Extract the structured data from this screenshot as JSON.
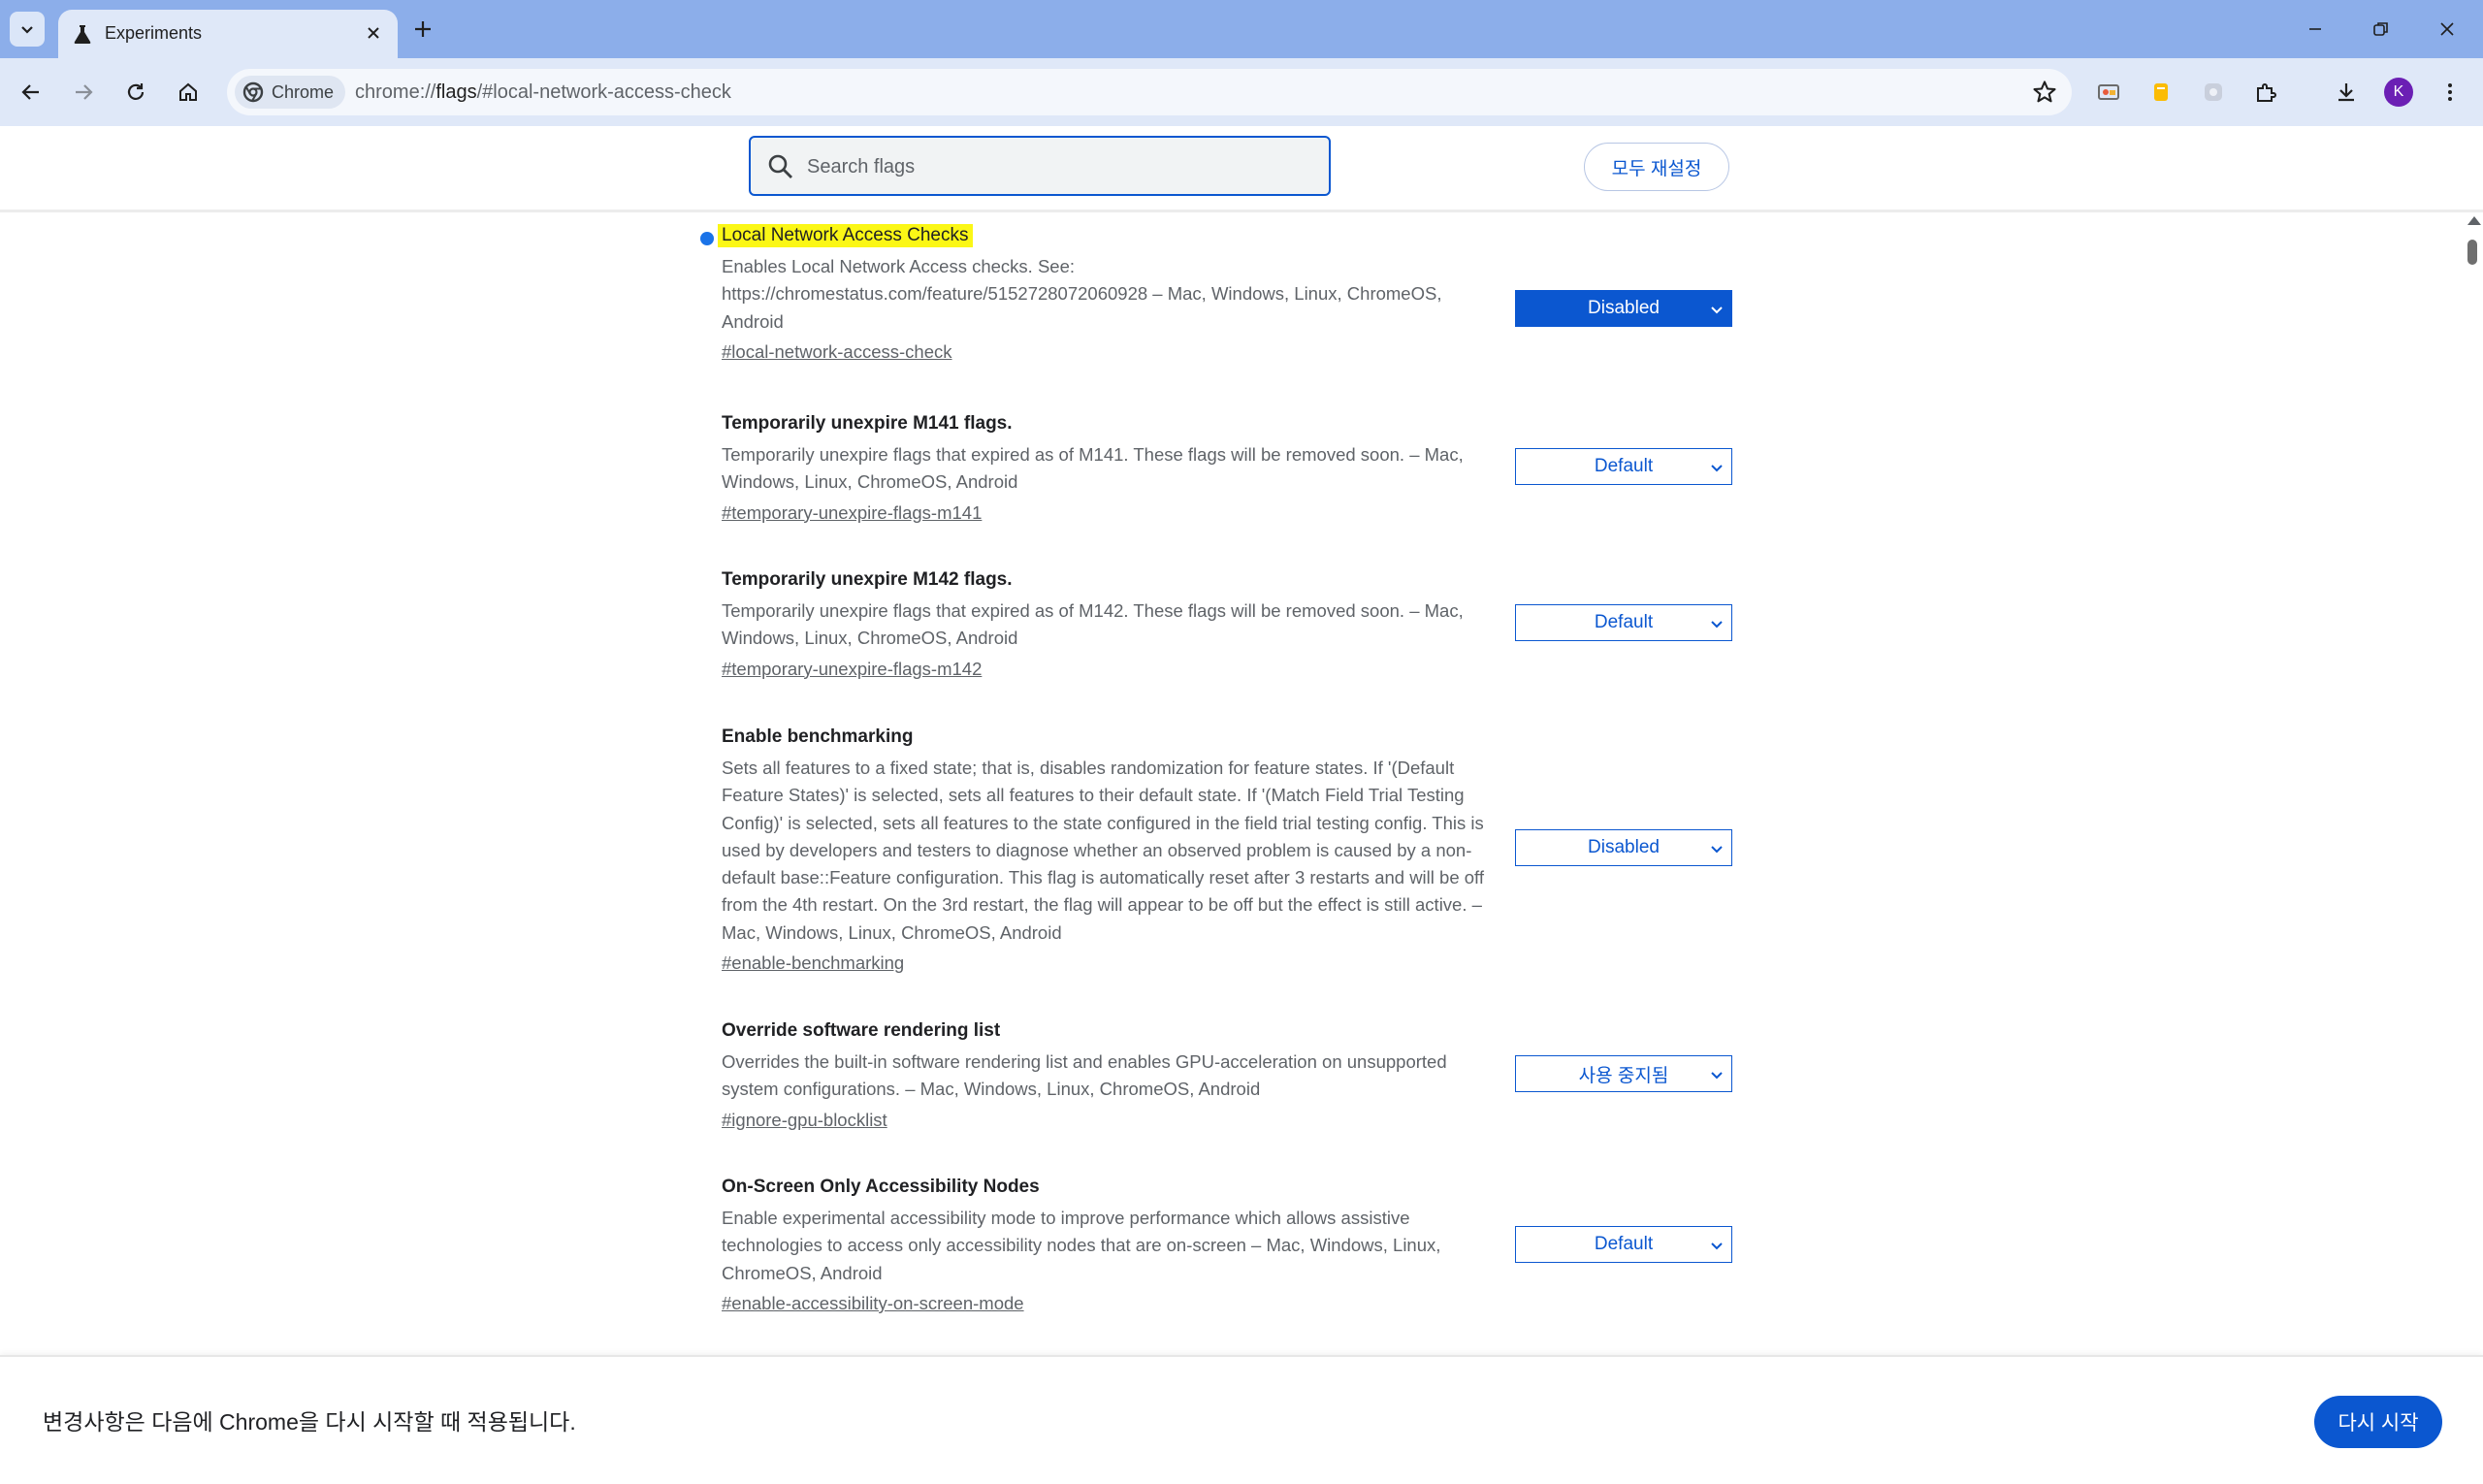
{
  "browser": {
    "tab": {
      "title": "Experiments"
    },
    "chip_label": "Chrome",
    "url": {
      "prefix": "chrome://",
      "host": "flags",
      "suffix": "/#local-network-access-check"
    },
    "avatar_letter": "K"
  },
  "header": {
    "search_placeholder": "Search flags",
    "reset_all_label": "모두 재설정"
  },
  "flags": [
    {
      "name": "Local Network Access Checks",
      "desc": "Enables Local Network Access checks. See: https://chromestatus.com/feature/5152728072060928 – Mac, Windows, Linux, ChromeOS, Android",
      "link": "#local-network-access-check",
      "value": "Disabled"
    },
    {
      "name": "Temporarily unexpire M141 flags.",
      "desc": "Temporarily unexpire flags that expired as of M141. These flags will be removed soon. – Mac, Windows, Linux, ChromeOS, Android",
      "link": "#temporary-unexpire-flags-m141",
      "value": "Default"
    },
    {
      "name": "Temporarily unexpire M142 flags.",
      "desc": "Temporarily unexpire flags that expired as of M142. These flags will be removed soon. – Mac, Windows, Linux, ChromeOS, Android",
      "link": "#temporary-unexpire-flags-m142",
      "value": "Default"
    },
    {
      "name": "Enable benchmarking",
      "desc": "Sets all features to a fixed state; that is, disables randomization for feature states. If '(Default Feature States)' is selected, sets all features to their default state. If '(Match Field Trial Testing Config)' is selected, sets all features to the state configured in the field trial testing config. This is used by developers and testers to diagnose whether an observed problem is caused by a non-default base::Feature configuration. This flag is automatically reset after 3 restarts and will be off from the 4th restart. On the 3rd restart, the flag will appear to be off but the effect is still active. – Mac, Windows, Linux, ChromeOS, Android",
      "link": "#enable-benchmarking",
      "value": "Disabled"
    },
    {
      "name": "Override software rendering list",
      "desc": "Overrides the built-in software rendering list and enables GPU-acceleration on unsupported system configurations. – Mac, Windows, Linux, ChromeOS, Android",
      "link": "#ignore-gpu-blocklist",
      "value": "사용 중지됨"
    },
    {
      "name": "On-Screen Only Accessibility Nodes",
      "desc": "Enable experimental accessibility mode to improve performance which allows assistive technologies to access only accessibility nodes that are on-screen – Mac, Windows, Linux, ChromeOS, Android",
      "link": "#enable-accessibility-on-screen-mode",
      "value": "Default"
    }
  ],
  "footer": {
    "message": "변경사항은 다음에 Chrome을 다시 시작할 때 적용됩니다.",
    "relaunch_label": "다시 시작"
  },
  "colors": {
    "accent": "#0b57d0",
    "highlight": "#fbf716",
    "tabstrip": "#8caeea",
    "toolbar": "#dfe8f8"
  }
}
